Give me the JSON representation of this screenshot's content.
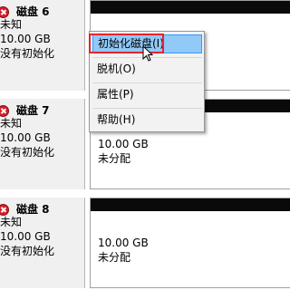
{
  "disks": [
    {
      "title": "磁盘 6",
      "type": "未知",
      "size": "10.00 GB",
      "state": "没有初始化",
      "partition": {
        "size": "",
        "status": ""
      }
    },
    {
      "title": "磁盘 7",
      "type": "未知",
      "size": "10.00 GB",
      "state": "没有初始化",
      "partition": {
        "size": "10.00 GB",
        "status": "未分配"
      }
    },
    {
      "title": "磁盘 8",
      "type": "未知",
      "size": "10.00 GB",
      "state": "没有初始化",
      "partition": {
        "size": "10.00 GB",
        "status": "未分配"
      }
    }
  ],
  "context_menu": {
    "items": [
      {
        "label": "初始化磁盘(I)",
        "highlighted": true
      },
      {
        "label": "脱机(O)"
      },
      {
        "label": "属性(P)"
      },
      {
        "label": "帮助(H)"
      }
    ]
  },
  "colors": {
    "info_panel": "#f0f0f0",
    "partition_bar": "#0a0a0a",
    "menu_bg": "#f2f2f2",
    "menu_highlight": "#91c9f7",
    "annotation_red": "#e8232d",
    "error_icon": "#d2202b"
  },
  "icons": {
    "disk_status": "error-icon",
    "pointer": "cursor-arrow-icon"
  }
}
